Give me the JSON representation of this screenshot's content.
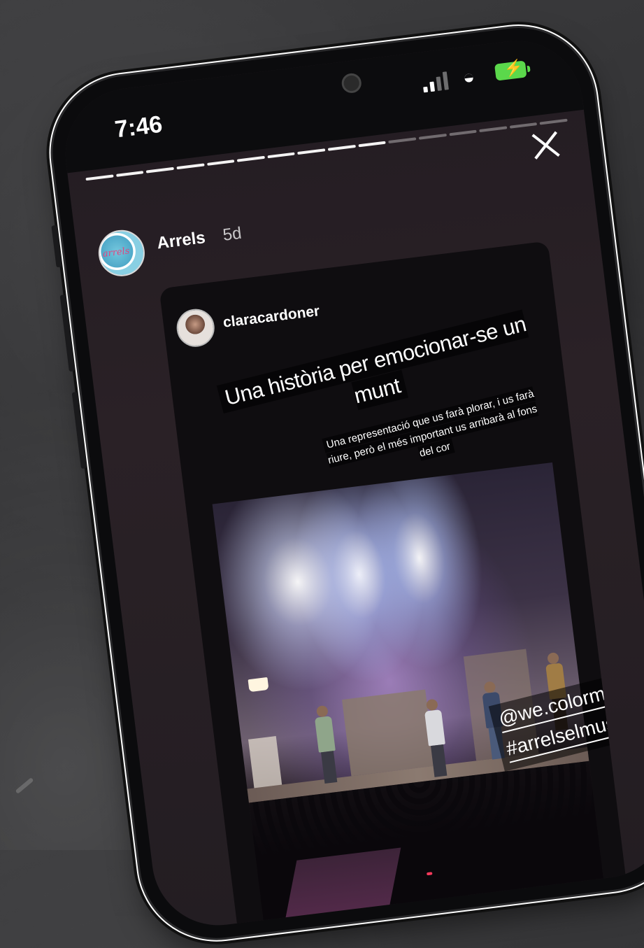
{
  "status_bar": {
    "time": "7:46"
  },
  "story": {
    "username": "Arrels",
    "time_ago": "5d",
    "avatar_text": "arrels",
    "progress": {
      "total_segments": 16,
      "completed_segments": 10
    }
  },
  "shared_post": {
    "username": "claracardoner",
    "headline": "Una història per  emocionar-se un munt",
    "subtext": "Una representació que us farà plorar, i us farà riure, però el més important us arribarà al fons del cor",
    "mention": "@we.colormusic",
    "hashtag": "#arrelselmusical"
  },
  "colors": {
    "battery": "#5bd84b",
    "screen_bg": "#231c22",
    "background": "#333335"
  },
  "icons": {
    "close": "close-icon",
    "wifi": "wifi-icon",
    "signal": "cellular-signal-icon",
    "battery": "battery-charging-icon"
  }
}
